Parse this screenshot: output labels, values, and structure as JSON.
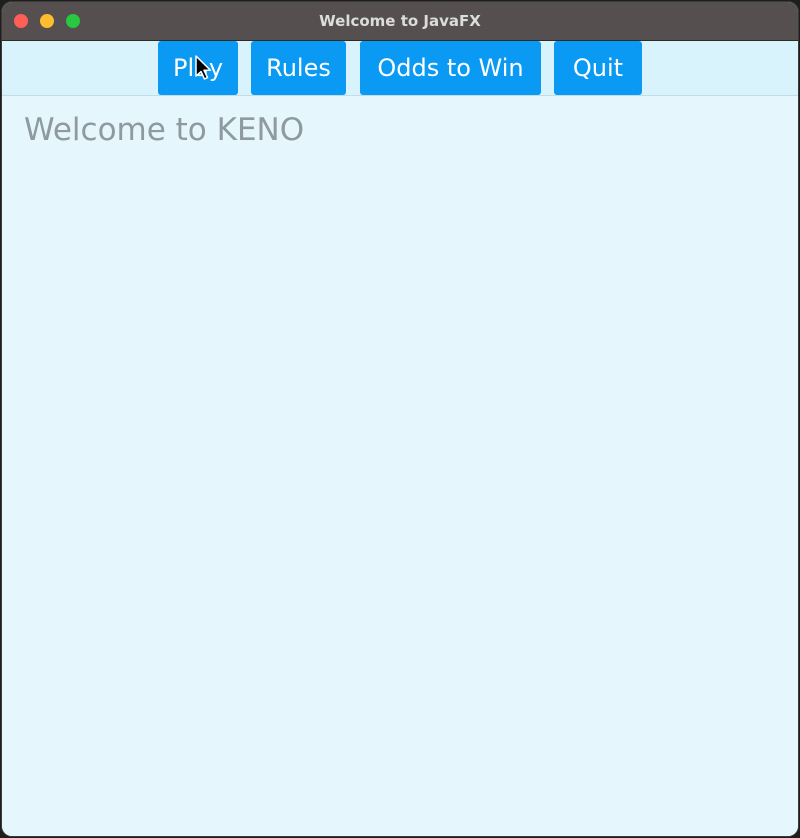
{
  "window": {
    "title": "Welcome to JavaFX"
  },
  "menu": {
    "play_label": "Play",
    "rules_label": "Rules",
    "odds_label": "Odds to Win",
    "quit_label": "Quit"
  },
  "main": {
    "welcome_text": "Welcome to KENO"
  },
  "colors": {
    "button_bg": "#0a9af3",
    "menubar_bg": "#d9f3fc",
    "content_bg": "#e6f6fd",
    "titlebar_bg": "#55504f",
    "welcome_text": "#8f9a9e"
  },
  "icons": {
    "close": "traffic-light-close-icon",
    "minimize": "traffic-light-minimize-icon",
    "maximize": "traffic-light-maximize-icon",
    "cursor": "mouse-pointer-icon"
  }
}
